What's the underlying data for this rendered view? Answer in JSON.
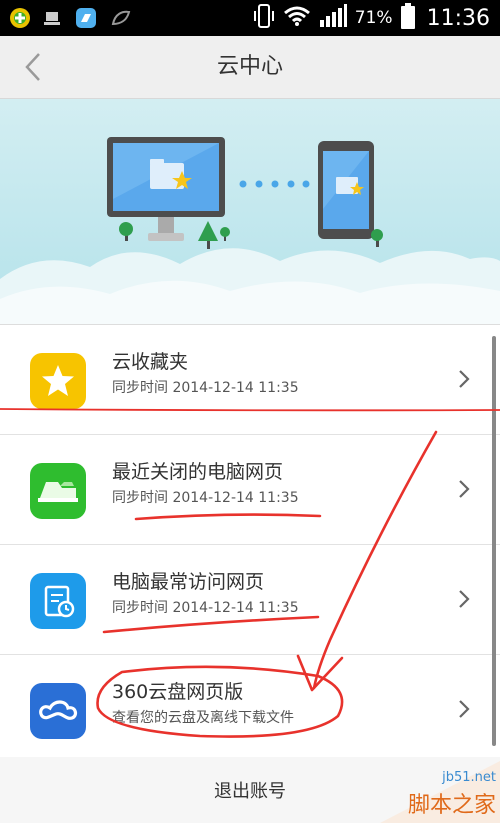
{
  "status_bar": {
    "battery": "71%",
    "time": "11:36",
    "icons": [
      "app-green-icon",
      "usb-icon",
      "app-blue-icon",
      "leaf-icon",
      "vibrate-icon",
      "wifi-icon",
      "signal-icon",
      "battery-icon"
    ]
  },
  "header": {
    "title": "云中心",
    "back_icon": "chevron-left-icon"
  },
  "items": [
    {
      "title": "云收藏夹",
      "subtitle": "同步时间 2014-12-14 11:35",
      "icon": "star-icon",
      "color": "#f7c400"
    },
    {
      "title": "最近关闭的电脑网页",
      "subtitle": "同步时间 2014-12-14 11:35",
      "icon": "tabs-icon",
      "color": "#2fbd2f"
    },
    {
      "title": "电脑最常访问网页",
      "subtitle": "同步时间 2014-12-14 11:35",
      "icon": "document-clock-icon",
      "color": "#1e9bea"
    },
    {
      "title": "360云盘网页版",
      "subtitle": "查看您的云盘及离线下载文件",
      "icon": "cloud-icon",
      "color": "#2a6fd6"
    }
  ],
  "logout": {
    "label": "退出账号"
  },
  "watermark": {
    "url": "jb51.net",
    "text": "脚本之家"
  }
}
